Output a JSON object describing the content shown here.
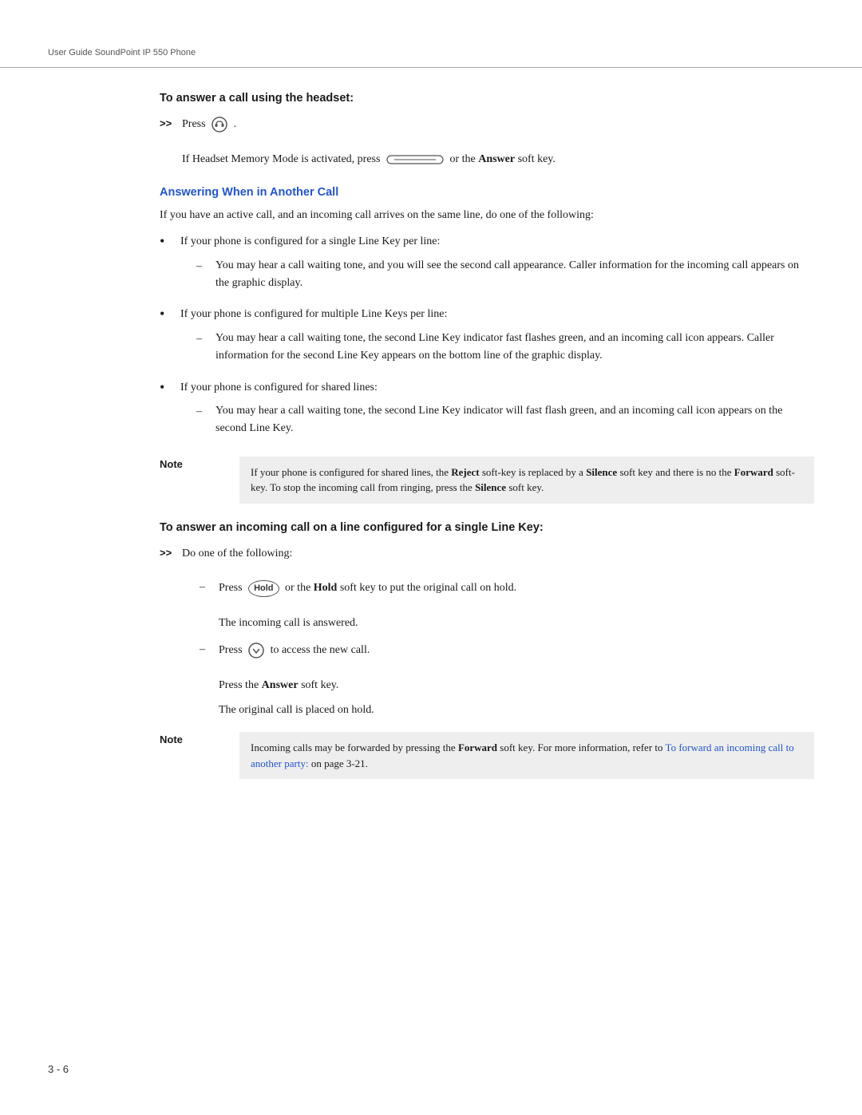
{
  "header": {
    "title": "User Guide SoundPoint IP 550 Phone"
  },
  "page_number": "3 - 6",
  "sections": [
    {
      "id": "answer-headset",
      "heading": "To answer a call using the headset:",
      "heading_type": "bold",
      "steps": [
        {
          "type": "arrow-bullet",
          "text": "Press",
          "icon": "headset-icon",
          "suffix": "."
        },
        {
          "type": "indent-text",
          "text": "If Headset Memory Mode is activated, press",
          "icon": "softkey-icon",
          "suffix": " or the",
          "bold_word": "Answer",
          "suffix2": " soft key."
        }
      ]
    },
    {
      "id": "answering-another-call",
      "heading": "Answering When in Another Call",
      "heading_type": "blue",
      "intro": "If you have an active call, and an incoming call arrives on the same line, do one of the following:",
      "bullet_items": [
        {
          "text": "If your phone is configured for a single Line Key per line:",
          "dash_items": [
            "You may hear a call waiting tone, and you will see the second call appearance. Caller information for the incoming call appears on the graphic display."
          ]
        },
        {
          "text": "If your phone is configured for multiple Line Keys per line:",
          "dash_items": [
            "You may hear a call waiting tone, the second Line Key indicator fast flashes green, and an incoming call icon appears. Caller information for the second Line Key appears on the bottom line of the graphic display."
          ]
        },
        {
          "text": "If your phone is configured for shared lines:",
          "dash_items": [
            "You may hear a call waiting tone, the second Line Key indicator will fast flash green, and an incoming call icon appears on the second Line Key."
          ]
        }
      ],
      "note": {
        "label": "Note",
        "text_parts": [
          {
            "text": "If your phone is configured for shared lines, the ",
            "bold": false
          },
          {
            "text": "Reject",
            "bold": true
          },
          {
            "text": " soft-key is replaced by a ",
            "bold": false
          },
          {
            "text": "Silence",
            "bold": true
          },
          {
            "text": " soft key and there is no the ",
            "bold": false
          },
          {
            "text": "Forward",
            "bold": true
          },
          {
            "text": " soft-key. To stop the incoming call from ringing, press the ",
            "bold": false
          },
          {
            "text": "Silence",
            "bold": true
          },
          {
            "text": " soft key.",
            "bold": false
          }
        ]
      }
    },
    {
      "id": "answer-single-line-key",
      "heading": "To answer an incoming call on a line configured for a single Line Key:",
      "heading_type": "bold",
      "steps": [
        {
          "type": "arrow-bullet",
          "text": "Do one of the following:"
        },
        {
          "type": "dash-item",
          "text_parts": [
            {
              "text": "Press ",
              "bold": false
            },
            {
              "text": "Hold",
              "bold": false,
              "icon": "hold-icon"
            },
            {
              "text": " or the ",
              "bold": false
            },
            {
              "text": "Hold",
              "bold": true
            },
            {
              "text": " soft key to put the original call on hold.",
              "bold": false
            }
          ]
        },
        {
          "type": "indent-plain",
          "text": "The incoming call is answered."
        },
        {
          "type": "dash-item",
          "text_parts": [
            {
              "text": "Press ",
              "bold": false
            },
            {
              "text": "",
              "bold": false,
              "icon": "nav-down-icon"
            },
            {
              "text": " to access the new call.",
              "bold": false
            }
          ]
        },
        {
          "type": "indent-plain",
          "text_parts": [
            {
              "text": "Press the ",
              "bold": false
            },
            {
              "text": "Answer",
              "bold": true
            },
            {
              "text": " soft key.",
              "bold": false
            }
          ]
        },
        {
          "type": "indent-plain2",
          "text": "The original call is placed on hold."
        }
      ],
      "note": {
        "label": "Note",
        "text_parts": [
          {
            "text": "Incoming calls may be forwarded by pressing the ",
            "bold": false
          },
          {
            "text": "Forward",
            "bold": true
          },
          {
            "text": " soft key. For more information, refer to ",
            "bold": false
          },
          {
            "text": "To forward an incoming call to another party:",
            "bold": false,
            "link": true
          },
          {
            "text": " on page 3-21.",
            "bold": false
          }
        ]
      }
    }
  ]
}
